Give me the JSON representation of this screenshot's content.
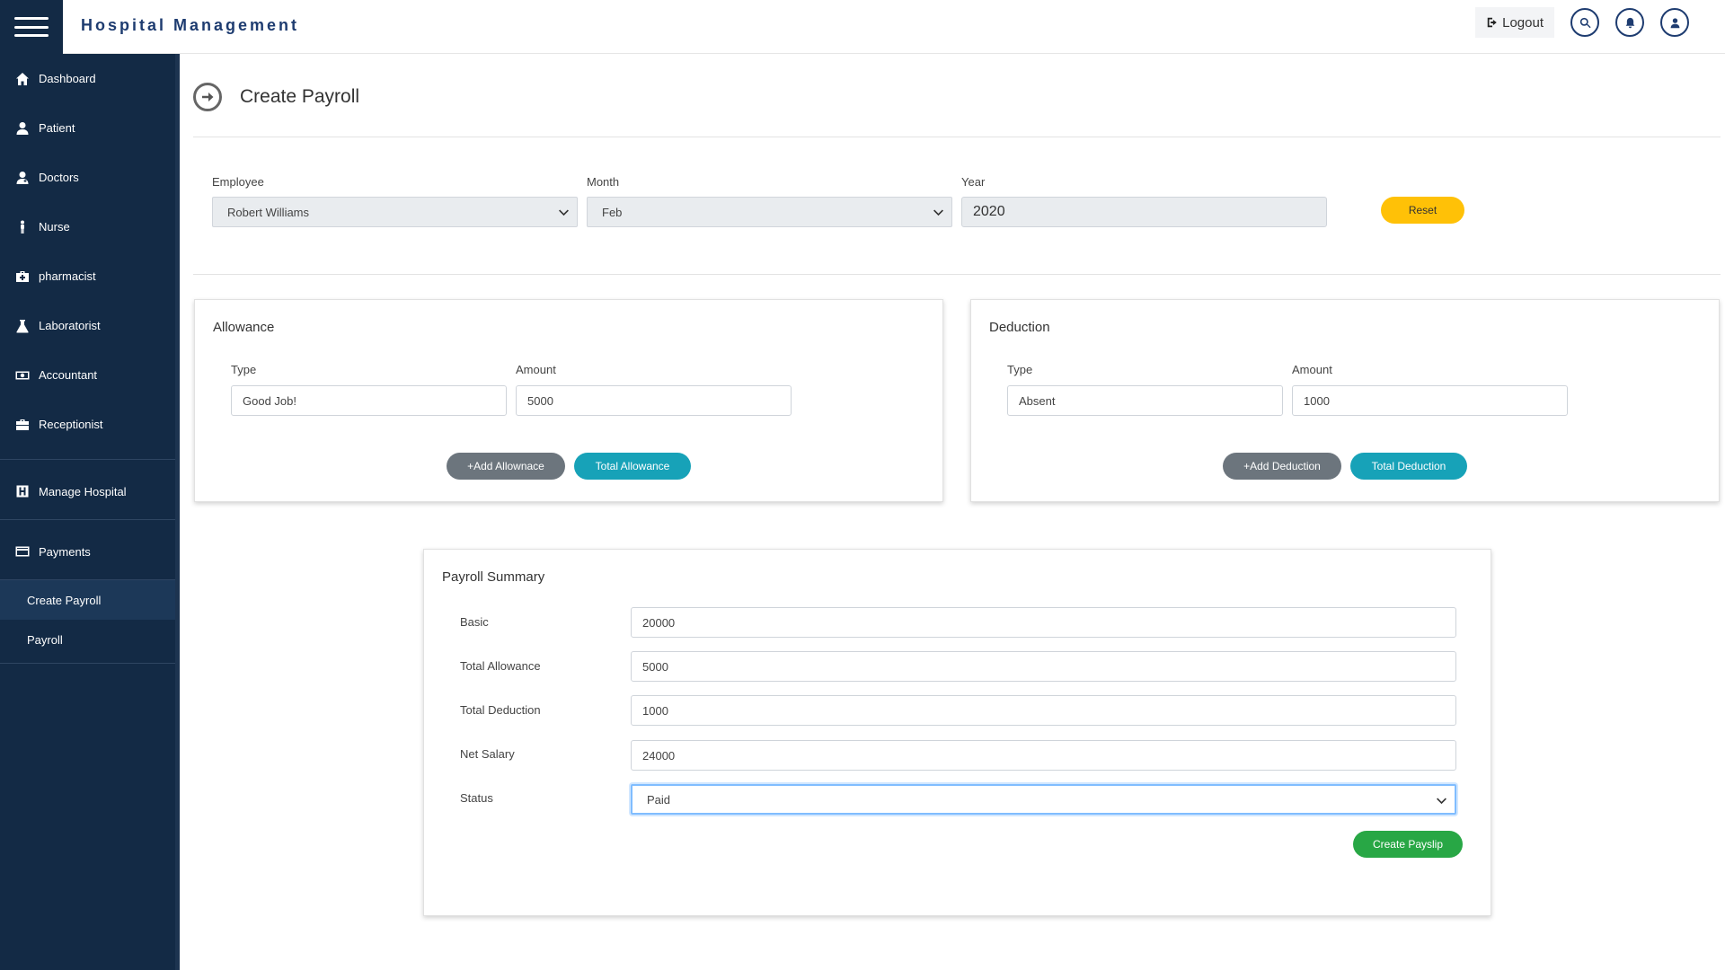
{
  "app": {
    "title": "Hospital Management"
  },
  "header": {
    "logout_label": "Logout"
  },
  "sidebar": {
    "items": [
      {
        "label": "Dashboard",
        "icon": "home-icon"
      },
      {
        "label": "Patient",
        "icon": "user-icon"
      },
      {
        "label": "Doctors",
        "icon": "doctor-icon"
      },
      {
        "label": "Nurse",
        "icon": "nurse-icon"
      },
      {
        "label": "pharmacist",
        "icon": "medkit-icon"
      },
      {
        "label": "Laboratorist",
        "icon": "flask-icon"
      },
      {
        "label": "Accountant",
        "icon": "money-icon"
      },
      {
        "label": "Receptionist",
        "icon": "briefcase-icon"
      }
    ],
    "manage_hospital": "Manage Hospital",
    "payments": "Payments",
    "sub_items": [
      {
        "label": "Create Payroll",
        "active": true
      },
      {
        "label": "Payroll",
        "active": false
      }
    ]
  },
  "page": {
    "title": "Create Payroll"
  },
  "filters": {
    "employee_label": "Employee",
    "employee_value": "Robert Williams",
    "month_label": "Month",
    "month_value": "Feb",
    "year_label": "Year",
    "year_value": "2020",
    "reset_label": "Reset"
  },
  "allowance": {
    "title": "Allowance",
    "type_label": "Type",
    "amount_label": "Amount",
    "type_value": "Good Job!",
    "amount_value": "5000",
    "add_label": "+Add Allownace",
    "total_label": "Total Allowance"
  },
  "deduction": {
    "title": "Deduction",
    "type_label": "Type",
    "amount_label": "Amount",
    "type_value": "Absent",
    "amount_value": "1000",
    "add_label": "+Add Deduction",
    "total_label": "Total Deduction"
  },
  "summary": {
    "title": "Payroll Summary",
    "basic_label": "Basic",
    "basic_value": "20000",
    "total_allowance_label": "Total Allowance",
    "total_allowance_value": "5000",
    "total_deduction_label": "Total Deduction",
    "total_deduction_value": "1000",
    "net_salary_label": "Net Salary",
    "net_salary_value": "24000",
    "status_label": "Status",
    "status_value": "Paid",
    "create_label": "Create Payslip"
  },
  "colors": {
    "sidebar_bg": "#132a45",
    "brand_text": "#1e3c70",
    "reset": "#ffc107",
    "teal": "#17a2b8",
    "gray_button": "#6c757d",
    "green": "#28a745"
  }
}
